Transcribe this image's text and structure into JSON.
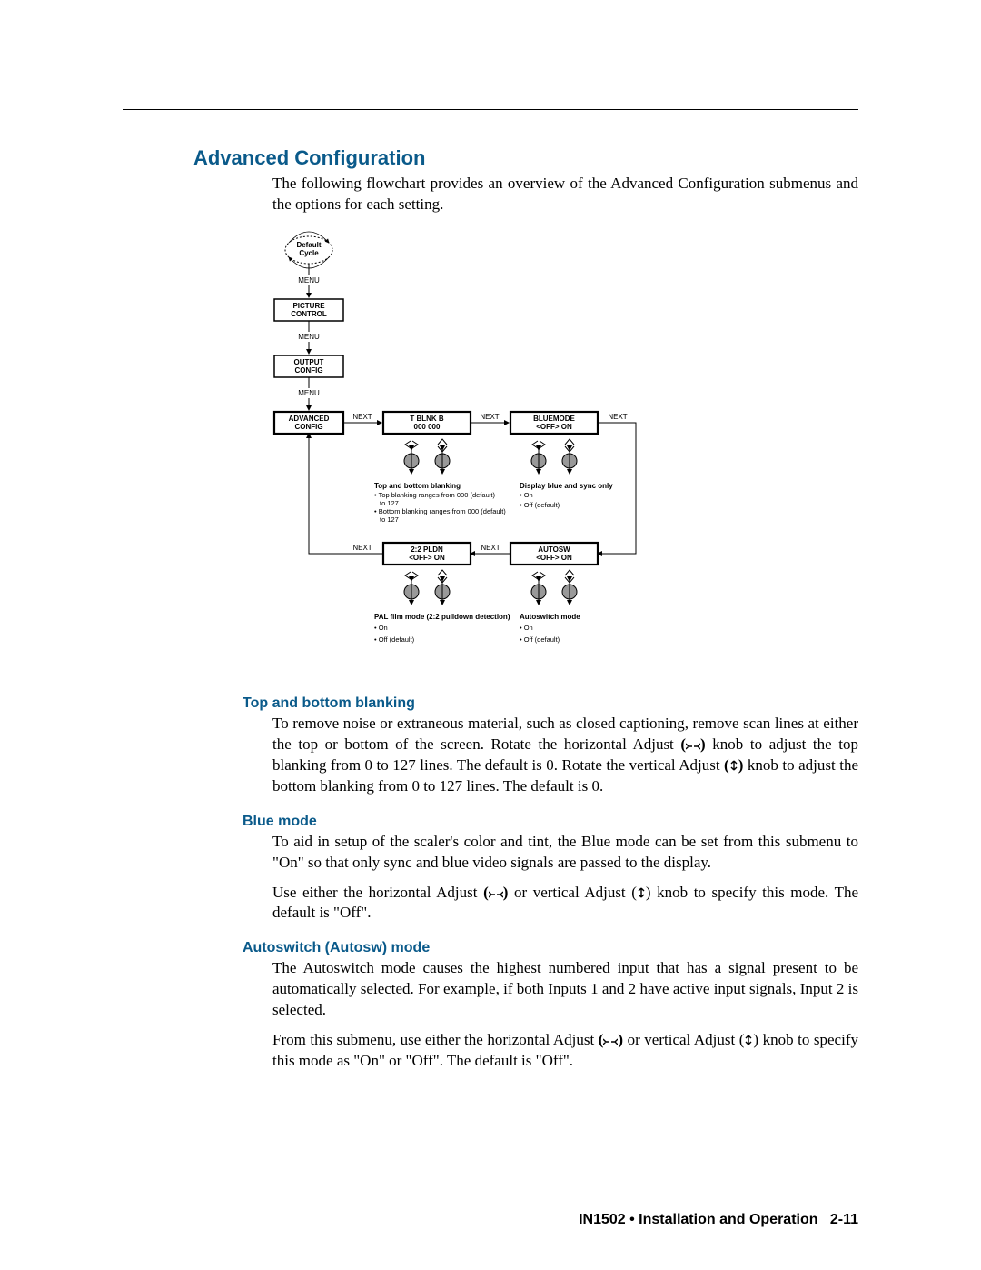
{
  "title": "Advanced Configuration",
  "intro": "The following flowchart provides an overview of the Advanced Configuration submenus and the options for each setting.",
  "diagram": {
    "default_cycle": "Default\nCycle",
    "menu_label": "MENU",
    "next_label": "NEXT",
    "boxes": {
      "picture_control": "PICTURE\nCONTROL",
      "output_config": "OUTPUT\nCONFIG",
      "advanced_config": "ADVANCED\nCONFIG",
      "blnk": {
        "line1": "T   BLNK   B",
        "line2": "000         000"
      },
      "bluemode": {
        "line1": "BLUEMODE",
        "line2": "<OFF>   ON"
      },
      "pldn": {
        "line1": "2:2 PLDN",
        "line2": "<OFF>   ON"
      },
      "autosw": {
        "line1": "AUTOSW",
        "line2": "<OFF>   ON"
      }
    },
    "notes": {
      "blnk_title": "Top and bottom blanking",
      "blnk_b1": "Top blanking ranges from 000 (default) to 127",
      "blnk_b2": "Bottom blanking ranges from 000 (default) to 127",
      "blue_title": "Display blue and sync only",
      "blue_b1": "On",
      "blue_b2": "Off (default)",
      "pldn_title": "PAL film mode (2:2 pulldown detection)",
      "pldn_b1": "On",
      "pldn_b2": "Off (default)",
      "autosw_title": "Autoswitch mode",
      "autosw_b1": "On",
      "autosw_b2": "Off (default)"
    }
  },
  "sections": {
    "blank": {
      "heading": "Top and bottom blanking",
      "p1a": "To remove noise or extraneous material, such as closed captioning, remove scan lines at either the top or bottom of the screen.  Rotate the horizontal Adjust ",
      "p1b": " knob to adjust the top blanking from 0 to 127 lines.  The default is 0.  Rotate the vertical Adjust ",
      "p1c": " knob to adjust the bottom blanking from 0 to 127 lines.  The default is 0."
    },
    "blue": {
      "heading": "Blue mode",
      "p1": "To aid in setup of the scaler's color and tint, the Blue mode can be set from this submenu to \"On\" so that only sync and blue video signals are passed to the display.",
      "p2a": "Use either the horizontal Adjust ",
      "p2b": " or vertical Adjust ",
      "p2c": " knob to specify this mode.  The default is \"Off\"."
    },
    "autosw": {
      "heading": "Autoswitch (Autosw) mode",
      "p1": "The Autoswitch mode causes the highest numbered input that has a signal present to be automatically selected.  For example, if both Inputs 1 and 2 have active input signals, Input 2 is selected.",
      "p2a": "From this submenu, use either the horizontal Adjust ",
      "p2b": " or vertical Adjust ",
      "p2c": " knob to specify this mode as \"On\" or \"Off\".  The default is \"Off\"."
    }
  },
  "footer": {
    "text": "IN1502 • Installation and Operation",
    "page": "2-11"
  }
}
